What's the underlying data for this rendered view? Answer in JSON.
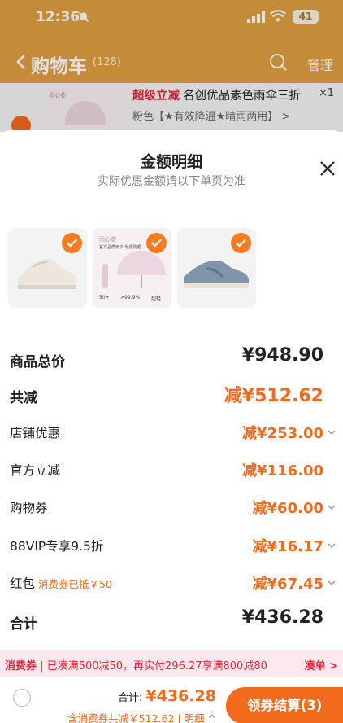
{
  "status_bar": {
    "time": "12:36",
    "battery": "41"
  },
  "cart_header": {
    "title": "购物车",
    "count": "(128)",
    "manage": "管理"
  },
  "cart_item": {
    "promo": "超级立减",
    "title": "名创优品素色雨伞三折",
    "spec": "粉色【★有效降温★晴雨两用】 >",
    "qty": "×1",
    "brand": "雨心巷"
  },
  "sheet": {
    "title": "金额明细",
    "subtitle": "实际优惠金额请以下单页为准",
    "thumbs": {
      "umbrella": {
        "brand": "雨心巷",
        "line": "官方品质雨伞 轻便防晒",
        "stat1": "50+",
        "stat2": ">99.9%",
        "stat3": "超轻"
      }
    },
    "rows": [
      {
        "label": "商品总价",
        "value": "¥948.90",
        "style": "black-bold",
        "chevron": false
      },
      {
        "label": "共减",
        "value": "减¥512.62",
        "style": "orange-big",
        "chevron": false
      },
      {
        "label": "店铺优惠",
        "value": "减¥253.00",
        "style": "orange",
        "chevron": true
      },
      {
        "label": "官方立减",
        "value": "减¥116.00",
        "style": "orange",
        "chevron": false
      },
      {
        "label": "购物券",
        "value": "减¥60.00",
        "style": "orange",
        "chevron": true
      },
      {
        "label": "88VIP专享9.5折",
        "value": "减¥16.17",
        "style": "orange",
        "chevron": true
      },
      {
        "label": "红包",
        "tag": "消费券已抵￥50",
        "value": "减¥67.45",
        "style": "orange",
        "chevron": true
      },
      {
        "label": "合计",
        "value": "¥436.28",
        "style": "black-bold",
        "chevron": false
      }
    ]
  },
  "coupon_bar": {
    "label": "消费券",
    "text": "已凑满500减50，再实付296.27享满800减80",
    "link": "凑单 >"
  },
  "footer": {
    "total_label": "合计:",
    "total_amount": "¥436.28",
    "discount_text": "含消费券共减￥512.62 | 明细 ^",
    "checkout": "领券结算(3)"
  },
  "colors": {
    "accent": "#f26b1d",
    "promo_red": "#e0283a",
    "header_bg": "#e0a040"
  }
}
